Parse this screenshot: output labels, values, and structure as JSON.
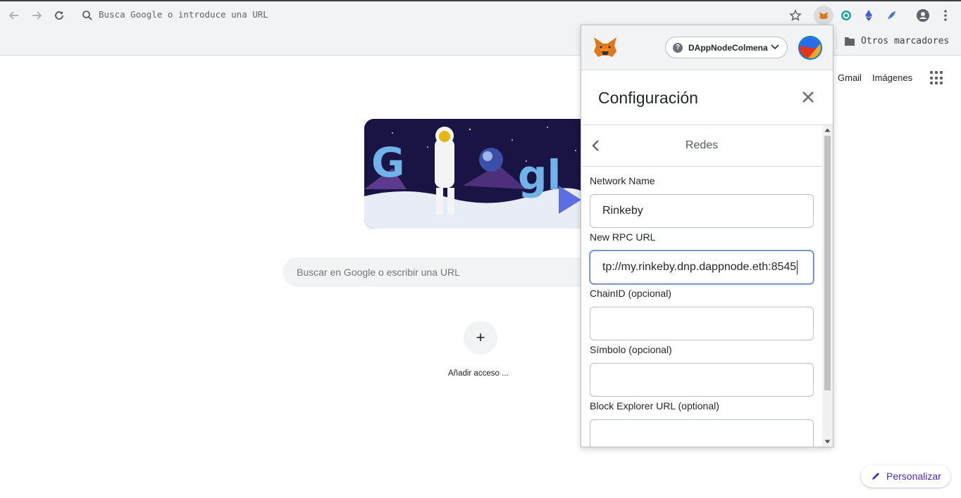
{
  "browser": {
    "omnibox_placeholder": "Busca Google o introduce una URL",
    "bookmark_folder": "Otros marcadores"
  },
  "newtab": {
    "gmail": "Gmail",
    "images": "Imágenes",
    "search_placeholder": "Buscar en Google o escribir una URL",
    "add_shortcut_icon": "+",
    "add_shortcut": "Añadir acceso ...",
    "customize": "Personalizar"
  },
  "metamask": {
    "network": "DAppNodeColmena",
    "title": "Configuración",
    "subheader": "Redes",
    "fields": [
      {
        "label": "Network Name",
        "value": "Rinkeby"
      },
      {
        "label": "New RPC URL",
        "value": "tp://my.rinkeby.dnp.dappnode.eth:8545"
      },
      {
        "label": "ChainID (opcional)",
        "value": ""
      },
      {
        "label": "Símbolo (opcional)",
        "value": ""
      },
      {
        "label": "Block Explorer URL (optional)",
        "value": ""
      }
    ]
  },
  "colors": {
    "accent": "#4b2bc6",
    "mm_blue": "#037dd6"
  }
}
